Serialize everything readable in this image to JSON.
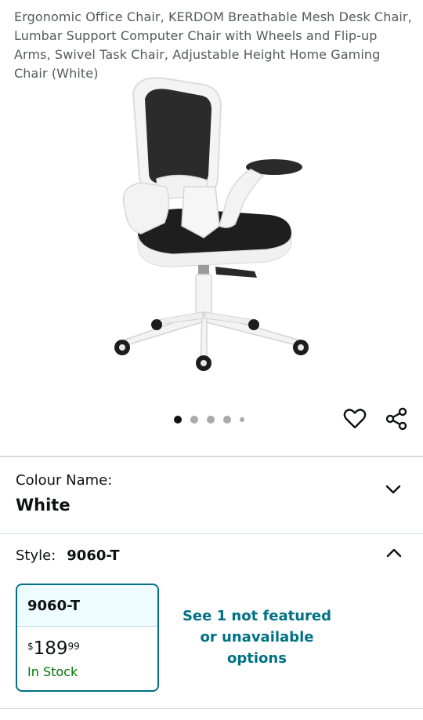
{
  "product": {
    "title": "Ergonomic Office Chair, KERDOM Breathable Mesh Desk Chair, Lumbar Support Computer Chair with Wheels and Flip-up Arms, Swivel Task Chair, Adjustable Height Home Gaming Chair (White)",
    "image_alt": "White ergonomic mesh office chair"
  },
  "gallery": {
    "image_count": 5,
    "active_index": 0,
    "wishlist_icon": "heart-icon",
    "share_icon": "share-icon"
  },
  "colour": {
    "label": "Colour Name:",
    "value": "White",
    "toggle_icon": "chevron-down-icon"
  },
  "style": {
    "label": "Style:",
    "value": "9060-T",
    "toggle_icon": "chevron-up-icon",
    "options": [
      {
        "name": "9060-T",
        "price_symbol": "$",
        "price_whole": "189",
        "price_fraction": "99",
        "availability": "In Stock"
      }
    ],
    "see_more": "See 1 not featured or unavailable options"
  },
  "colors": {
    "accent": "#007185",
    "in_stock": "#007600",
    "selected_swatch_bg": "#edfdff",
    "divider": "#d5d9d9"
  }
}
